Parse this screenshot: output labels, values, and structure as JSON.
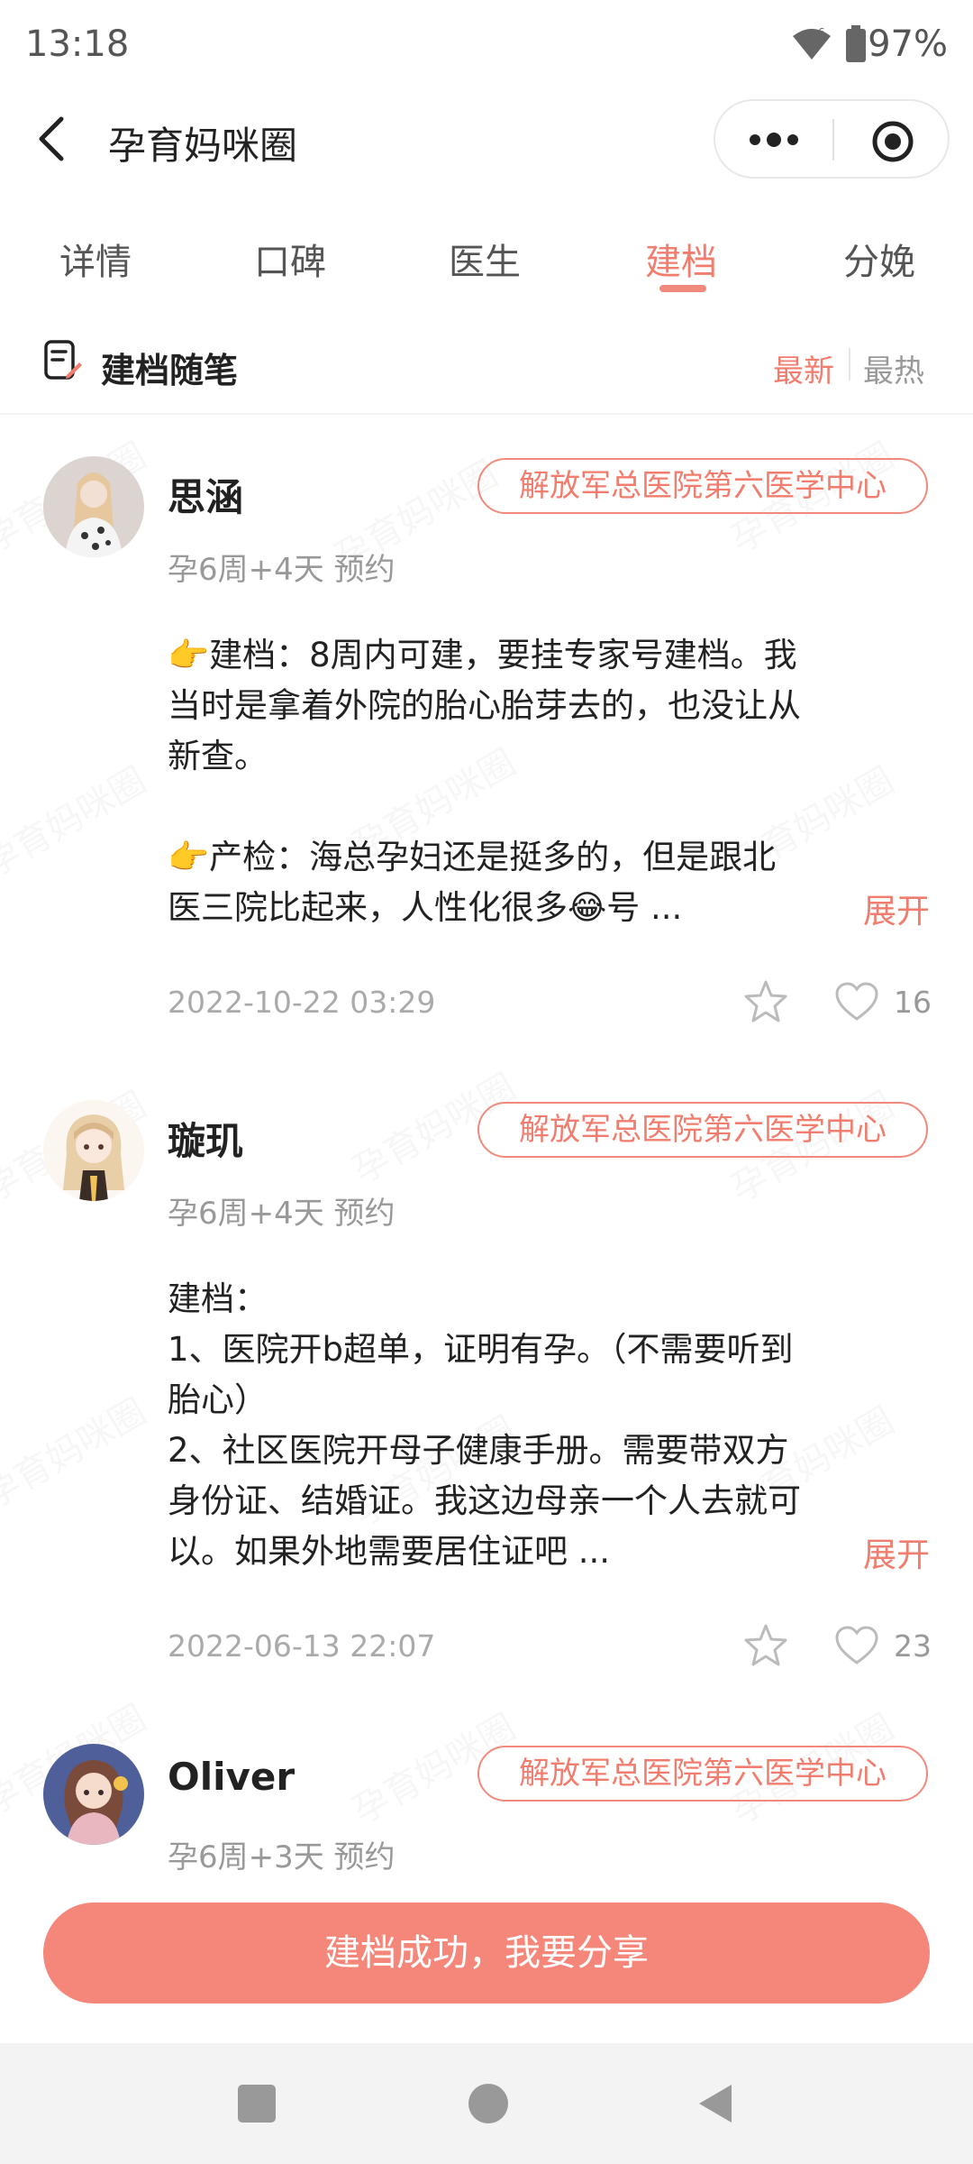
{
  "status_bar": {
    "time": "13:18",
    "battery": "97%"
  },
  "header": {
    "title": "孕育妈咪圈"
  },
  "tabs": [
    {
      "label": "详情"
    },
    {
      "label": "口碑"
    },
    {
      "label": "医生"
    },
    {
      "label": "建档",
      "active": true
    },
    {
      "label": "分娩"
    }
  ],
  "section": {
    "title": "建档随笔",
    "sort_new": "最新",
    "sort_hot": "最热"
  },
  "posts": [
    {
      "username": "思涵",
      "hospital": "解放军总医院第六医学中心",
      "meta": "孕6周+4天 预约",
      "lines": [
        "👉建档：8周内可建，要挂专家号建档。我",
        "当时是拿着外院的胎心胎芽去的，也没让从",
        "新查。",
        "",
        "👉产检：海总孕妇还是挺多的，但是跟北",
        "医三院比起来，人性化很多😂号 ..."
      ],
      "expand": "展开",
      "date": "2022-10-22 03:29",
      "likes": "16"
    },
    {
      "username": "璇玑",
      "hospital": "解放军总医院第六医学中心",
      "meta": "孕6周+4天 预约",
      "lines": [
        "建档：",
        "1、医院开b超单，证明有孕。（不需要听到",
        "胎心）",
        "2、社区医院开母子健康手册。需要带双方",
        "身份证、结婚证。我这边母亲一个人去就可",
        "以。如果外地需要居住证吧 ..."
      ],
      "expand": "展开",
      "date": "2022-06-13 22:07",
      "likes": "23"
    },
    {
      "username": "Oliver",
      "hospital": "解放军总医院第六医学中心",
      "meta": "孕6周+3天 预约"
    }
  ],
  "share_button": "建档成功，我要分享",
  "watermark": "孕育妈咪圈",
  "colors": {
    "accent": "#f07d6e",
    "button": "#f5877a"
  }
}
